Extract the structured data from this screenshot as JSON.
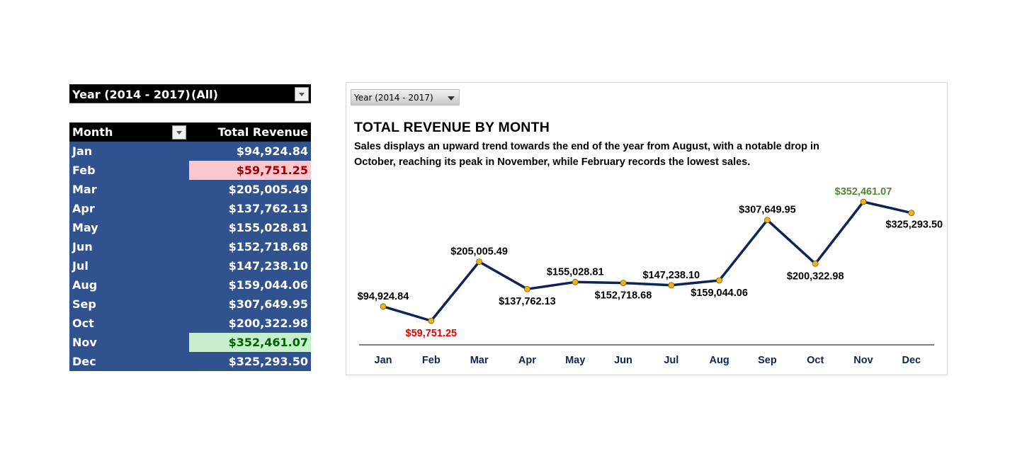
{
  "filter": {
    "label": "Year (2014 - 2017)",
    "value": "(All)"
  },
  "pivot": {
    "headers": {
      "month": "Month",
      "revenue": "Total Revenue"
    },
    "rows": [
      {
        "month": "Jan",
        "revenue": "$94,924.84"
      },
      {
        "month": "Feb",
        "revenue": "$59,751.25"
      },
      {
        "month": "Mar",
        "revenue": "$205,005.49"
      },
      {
        "month": "Apr",
        "revenue": "$137,762.13"
      },
      {
        "month": "May",
        "revenue": "$155,028.81"
      },
      {
        "month": "Jun",
        "revenue": "$152,718.68"
      },
      {
        "month": "Jul",
        "revenue": "$147,238.10"
      },
      {
        "month": "Aug",
        "revenue": "$159,044.06"
      },
      {
        "month": "Sep",
        "revenue": "$307,649.95"
      },
      {
        "month": "Oct",
        "revenue": "$200,322.98"
      },
      {
        "month": "Nov",
        "revenue": "$352,461.07"
      },
      {
        "month": "Dec",
        "revenue": "$325,293.50"
      }
    ]
  },
  "slicer": {
    "label": "Year (2014 - 2017)"
  },
  "chart_data": {
    "type": "line",
    "title": "TOTAL REVENUE BY MONTH",
    "subtitle": "Sales displays an upward trend towards the end of the year from August, with a notable drop in October, reaching its peak in November, while February records the lowest sales.",
    "categories": [
      "Jan",
      "Feb",
      "Mar",
      "Apr",
      "May",
      "Jun",
      "Jul",
      "Aug",
      "Sep",
      "Oct",
      "Nov",
      "Dec"
    ],
    "values": [
      94924.84,
      59751.25,
      205005.49,
      137762.13,
      155028.81,
      152718.68,
      147238.1,
      159044.06,
      307649.95,
      200322.98,
      352461.07,
      325293.5
    ],
    "data_labels": [
      "$94,924.84",
      "$59,751.25",
      "$205,005.49",
      "$137,762.13",
      "$155,028.81",
      "$152,718.68",
      "$147,238.10",
      "$159,044.06",
      "$307,649.95",
      "$200,322.98",
      "$352,461.07",
      "$325,293.50"
    ],
    "min_index": 1,
    "max_index": 10,
    "line_color": "#0d2556",
    "marker_color": "#f2b21b",
    "low_label_color": "#e30000",
    "high_label_color": "#4f8a2f",
    "grid": false,
    "legend": "none",
    "xlabel": "",
    "ylabel": ""
  },
  "colors": {
    "table_row_bg": "#30528f",
    "header_bg": "#000000",
    "low_bg": "#ffc6cd",
    "high_bg": "#c6efce"
  }
}
